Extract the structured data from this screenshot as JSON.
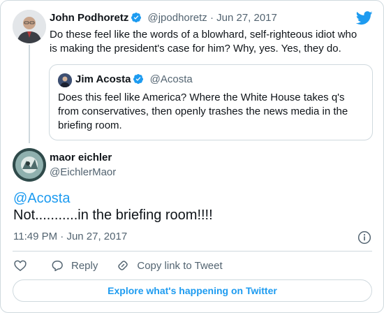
{
  "parent_tweet": {
    "author_name": "John Podhoretz",
    "author_handle": "@jpodhoretz",
    "separator": "·",
    "date": "Jun 27, 2017",
    "text": "Do these feel like the words of a blowhard, self-righteous idiot who is making the president's case for him? Why, yes. Yes, they do."
  },
  "quoted_tweet": {
    "author_name": "Jim Acosta",
    "author_handle": "@Acosta",
    "text": "Does this feel like America? Where the White House takes q's from conservatives, then openly trashes the news media in the briefing room."
  },
  "main_tweet": {
    "author_name": "maor eichler",
    "author_handle": "@EichlerMaor",
    "mention": "@Acosta",
    "text": "Not...........in the briefing room!!!!",
    "time": "11:49 PM",
    "separator": "·",
    "date": "Jun 27, 2017"
  },
  "actions": {
    "reply_label": "Reply",
    "copy_link_label": "Copy link to Tweet"
  },
  "explore_button_label": "Explore what's happening on Twitter",
  "icons": {
    "brand": "twitter-bird-icon",
    "verified": "verified-badge-icon",
    "like": "heart-icon",
    "reply": "reply-bubble-icon",
    "copy_link": "link-icon",
    "info": "info-icon"
  },
  "colors": {
    "accent": "#1d9bf0",
    "text": "#0f1419",
    "muted": "#536471",
    "border": "#cfd9de"
  }
}
